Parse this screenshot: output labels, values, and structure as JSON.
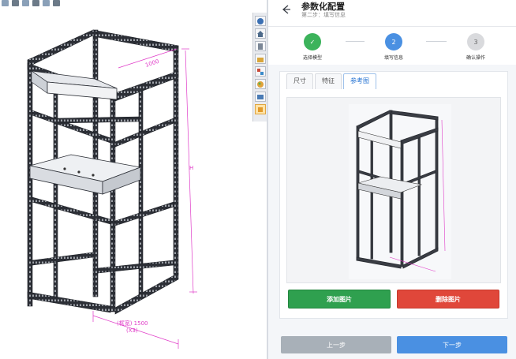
{
  "header": {
    "title": "参数化配置",
    "subtitle": "第二步：填写信息",
    "back_icon": "arrow-left-icon"
  },
  "steps": [
    {
      "number": "✓",
      "label": "选择模型",
      "state": "done"
    },
    {
      "number": "2",
      "label": "填写信息",
      "state": "active"
    },
    {
      "number": "3",
      "label": "确认操作",
      "state": "todo"
    }
  ],
  "tabs": [
    {
      "label": "尺寸",
      "active": false
    },
    {
      "label": "特征",
      "active": false
    },
    {
      "label": "参考图",
      "active": true
    }
  ],
  "buttons": {
    "add_image": "添加图片",
    "delete_image": "删除图片",
    "prev": "上一步",
    "next": "下一步"
  },
  "cad": {
    "dim_height": "H",
    "dim_width": "(框宽) 1500",
    "dim_width2": "(X3)",
    "dim_depth": "1000"
  },
  "taskpane_icons": [
    "solidworks-resources-icon",
    "home-icon",
    "design-library-icon",
    "file-explorer-icon",
    "view-palette-icon",
    "appearances-icon",
    "custom-properties-icon",
    "addin-panel-icon"
  ],
  "colors": {
    "accent": "#4a90e2",
    "done": "#3cb35b",
    "add": "#2fa04f",
    "delete": "#e0473a",
    "dimension": "#e03cc8"
  }
}
